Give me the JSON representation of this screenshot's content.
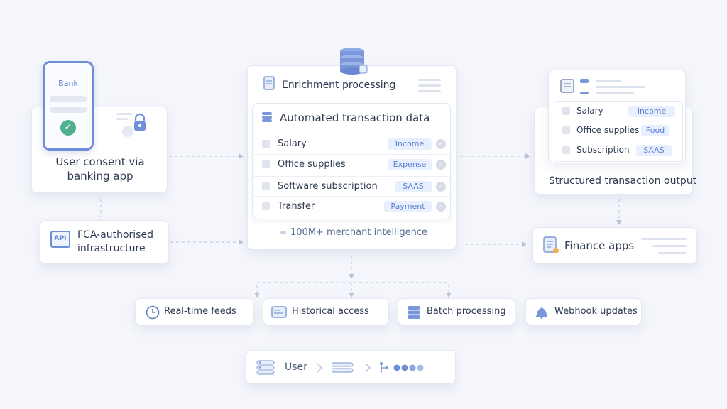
{
  "phone": {
    "bank_label": "Bank"
  },
  "consent": {
    "line1": "User consent via",
    "line2": "banking app"
  },
  "fca": {
    "line1": "FCA-authorised",
    "line2": "infrastructure",
    "badge": "API"
  },
  "enrichment": {
    "title": "Enrichment processing",
    "inner_title": "Automated transaction data",
    "rows": [
      {
        "label": "Salary",
        "tag": "Income"
      },
      {
        "label": "Office supplies",
        "tag": "Expense"
      },
      {
        "label": "Software subscription",
        "tag": "SAAS"
      },
      {
        "label": "Transfer",
        "tag": "Payment"
      }
    ],
    "footer": "100M+ merchant intelligence"
  },
  "structured": {
    "title": "Structured transaction output",
    "rows": [
      {
        "label": "Salary",
        "tag": "Income"
      },
      {
        "label": "Office supplies",
        "tag": "Food"
      },
      {
        "label": "Subscription",
        "tag": "SAAS"
      }
    ]
  },
  "finance": {
    "label": "Finance apps"
  },
  "features": [
    {
      "label": "Real-time feeds",
      "icon": "clock-icon"
    },
    {
      "label": "Historical access",
      "icon": "history-icon"
    },
    {
      "label": "Batch processing",
      "icon": "database-icon"
    },
    {
      "label": "Webhook updates",
      "icon": "bell-icon"
    }
  ],
  "flow": {
    "label": "User"
  },
  "colors": {
    "accent": "#5b7fd0",
    "accent_light": "#e8f0ff",
    "check": "#4fb08f"
  }
}
